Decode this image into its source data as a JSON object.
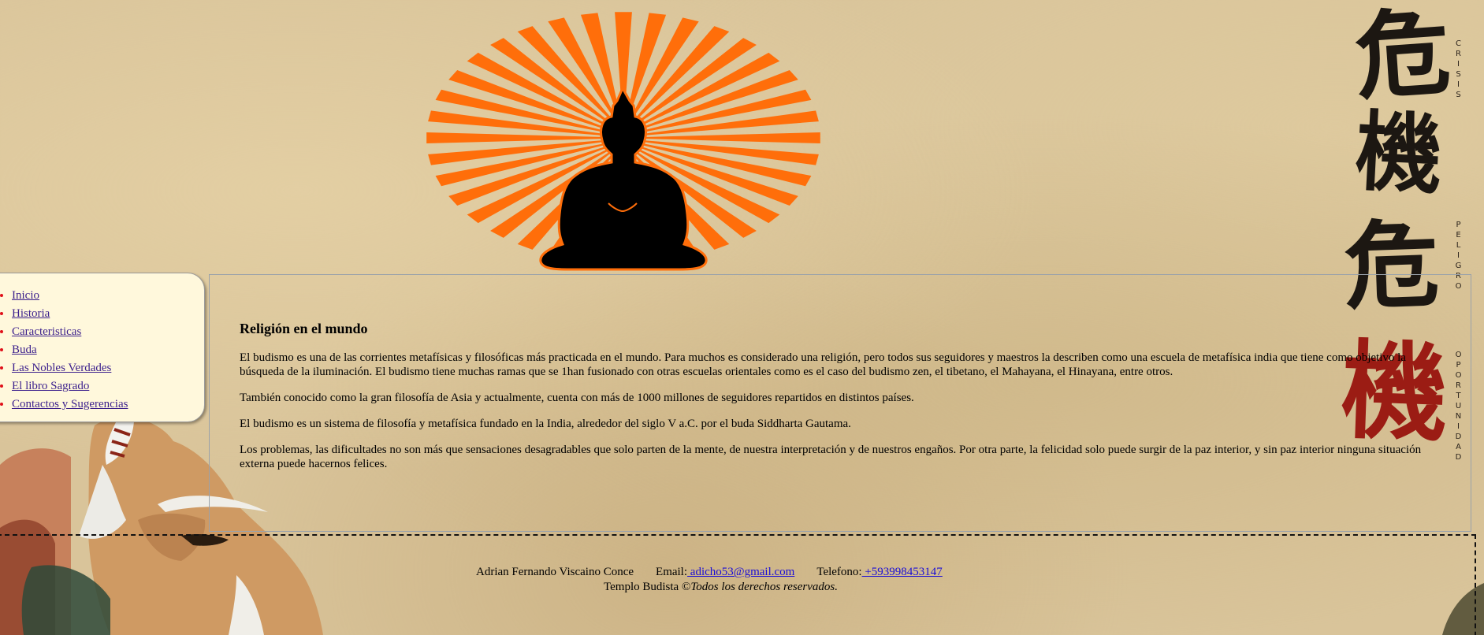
{
  "nav": {
    "items": [
      {
        "label": "Inicio"
      },
      {
        "label": "Historia"
      },
      {
        "label": "Caracteristicas"
      },
      {
        "label": "Buda"
      },
      {
        "label": "Las Nobles Verdades"
      },
      {
        "label": "El libro Sagrado"
      },
      {
        "label": "Contactos y Sugerencias"
      }
    ]
  },
  "content": {
    "heading": "Religión en el mundo",
    "paragraphs": [
      "El budismo es una de las corrientes metafísicas y filosóficas más practicada en el mundo. Para muchos es considerado una religión, pero todos sus seguidores y maestros la describen como una escuela de metafísica india que tiene como objetivo la búsqueda de la iluminación. El budismo tiene muchas ramas que se 1han fusionado con otras escuelas orientales como es el caso del budismo zen, el tibetano, el Mahayana, el Hinayana, entre otros.",
      "También conocido como la gran filosofía de Asia y actualmente, cuenta con más de 1000 millones de seguidores repartidos en distintos países.",
      "El budismo es un sistema de filosofía y metafísica fundado en la India, alrededor del siglo V a.C. por el buda Siddharta Gautama.",
      "Los problemas, las dificultades no son más que sensaciones desagradables que solo parten de la mente, de nuestra interpretación y de nuestros engaños. Por otra parte, la felicidad solo puede surgir de la paz interior, y sin paz interior ninguna situación externa puede hacernos felices."
    ]
  },
  "calligraphy": {
    "kanji": [
      "危",
      "機",
      "危",
      "機"
    ],
    "words": [
      "CRISIS",
      "PELIGRO",
      "OPORTUNIDAD"
    ]
  },
  "footer": {
    "author": "Adrian Fernando Viscaino Conce",
    "email_label": "Email:",
    "email_value": " adicho53@gmail.com",
    "phone_label": "Telefono:",
    "phone_value": " +593998453147",
    "copyright_prefix": "Templo Budista ©",
    "copyright_italic": "Todos los derechos reservados."
  },
  "colors": {
    "sunburst": "#ff6e0a",
    "nav_background": "#fff8dc",
    "nav_bullet": "#e0101a",
    "nav_link": "#3b1f8c",
    "footer_link": "#1a0dd6",
    "kanji_red": "#9b1c14"
  },
  "icons": {
    "logo": "buddha-sunburst-logo",
    "illustration": "old-monk-illustration"
  }
}
